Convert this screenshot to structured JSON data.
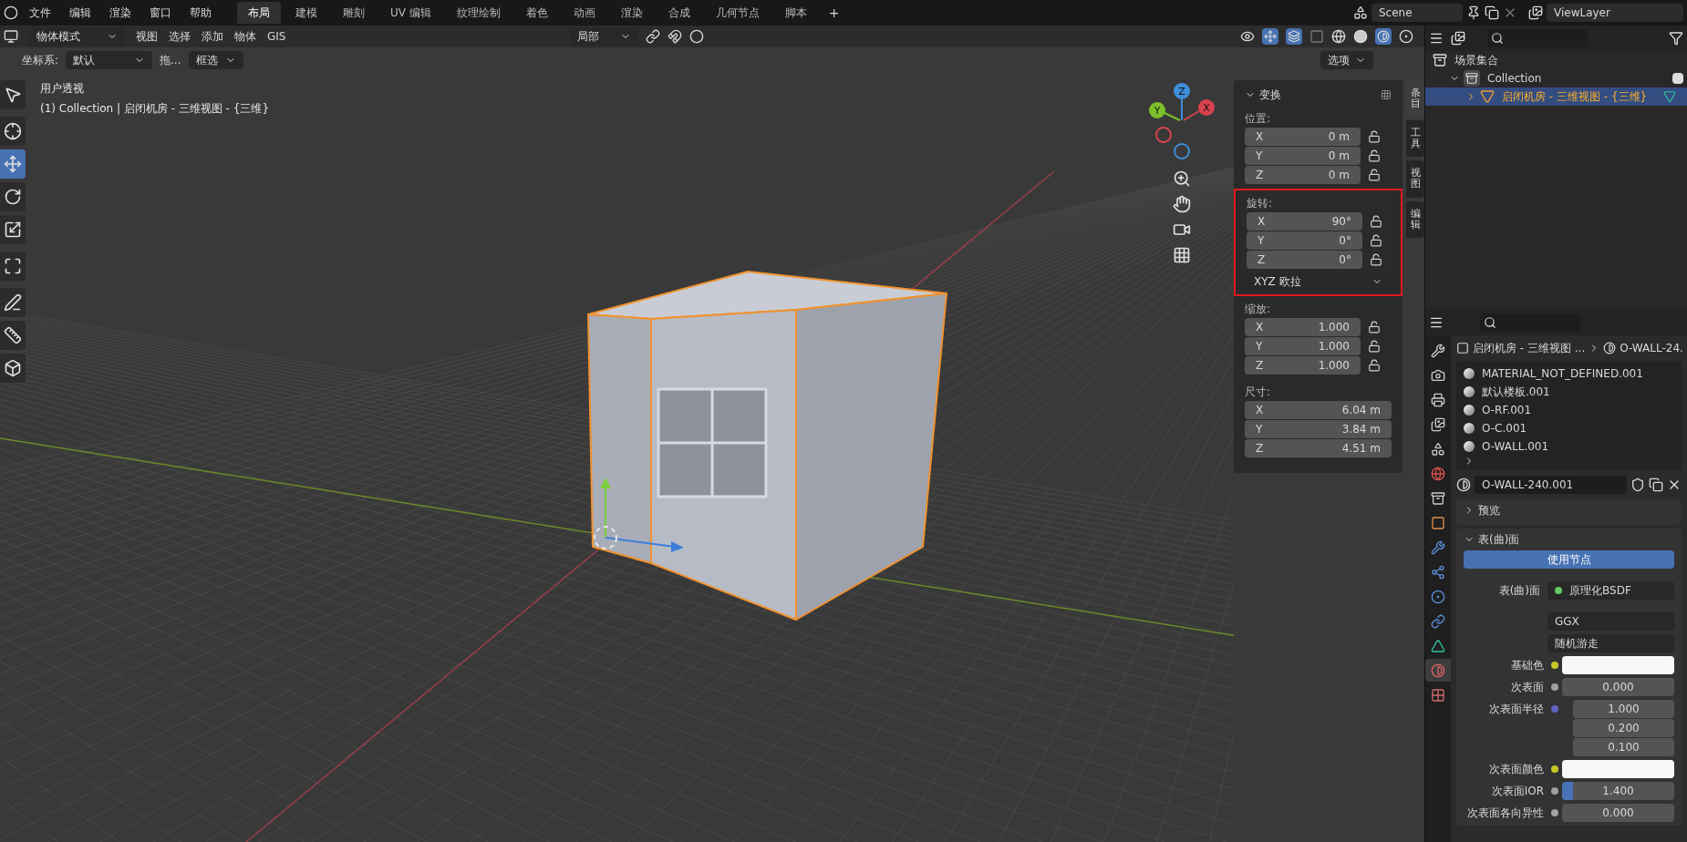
{
  "top_bar": {
    "menus": [
      "文件",
      "编辑",
      "渲染",
      "窗口",
      "帮助"
    ],
    "workspace_tabs": [
      {
        "label": "布局",
        "selected": true
      },
      {
        "label": "建模",
        "selected": false
      },
      {
        "label": "雕刻",
        "selected": false
      },
      {
        "label": "UV 编辑",
        "selected": false
      },
      {
        "label": "纹理绘制",
        "selected": false
      },
      {
        "label": "着色",
        "selected": false
      },
      {
        "label": "动画",
        "selected": false
      },
      {
        "label": "渲染",
        "selected": false
      },
      {
        "label": "合成",
        "selected": false
      },
      {
        "label": "几何节点",
        "selected": false
      },
      {
        "label": "脚本",
        "selected": false
      }
    ],
    "add_tab": "+",
    "scene": "Scene",
    "view_layer": "ViewLayer"
  },
  "viewport_header": {
    "mode": "物体模式",
    "menus": [
      "视图",
      "选择",
      "添加",
      "物体",
      "GIS"
    ],
    "pivot": "局部"
  },
  "tool_settings": {
    "orientation_label": "坐标系:",
    "orientation": "默认",
    "drag_label": "拖...",
    "drag": "框选",
    "options": "选项"
  },
  "toolbar": [
    {
      "kind": "select",
      "selected": false
    },
    {
      "kind": "cursor",
      "selected": false
    },
    {
      "kind": "move",
      "selected": true
    },
    {
      "kind": "rotate",
      "selected": false
    },
    {
      "kind": "scale",
      "selected": false
    },
    {
      "kind": "transform",
      "selected": false
    },
    {
      "kind": "annotate",
      "selected": false
    },
    {
      "kind": "measure",
      "selected": false
    },
    {
      "kind": "add_cube",
      "selected": false
    }
  ],
  "viewport": {
    "view_name": "用户透视",
    "context": "(1) Collection | 启闭机房 - 三维视图 - {三维}"
  },
  "gizmo": {
    "x": "X",
    "y": "Y",
    "z": "Z"
  },
  "n_panel": {
    "title": "变换",
    "groups": [
      {
        "label": "位置:",
        "locks": true,
        "highlighted": false,
        "rows": [
          {
            "axis": "X",
            "value": "0 m"
          },
          {
            "axis": "Y",
            "value": "0 m"
          },
          {
            "axis": "Z",
            "value": "0 m"
          }
        ]
      },
      {
        "label": "旋转:",
        "locks": true,
        "highlighted": true,
        "mode_dropdown": "XYZ 欧拉",
        "rows": [
          {
            "axis": "X",
            "value": "90°"
          },
          {
            "axis": "Y",
            "value": "0°"
          },
          {
            "axis": "Z",
            "value": "0°"
          }
        ]
      },
      {
        "label": "缩放:",
        "locks": true,
        "highlighted": false,
        "rows": [
          {
            "axis": "X",
            "value": "1.000"
          },
          {
            "axis": "Y",
            "value": "1.000"
          },
          {
            "axis": "Z",
            "value": "1.000"
          }
        ]
      },
      {
        "label": "尺寸:",
        "locks": false,
        "highlighted": false,
        "rows": [
          {
            "axis": "X",
            "value": "6.04 m"
          },
          {
            "axis": "Y",
            "value": "3.84 m"
          },
          {
            "axis": "Z",
            "value": "4.51 m"
          }
        ]
      }
    ],
    "tabs": [
      {
        "label": "条目",
        "selected": true
      },
      {
        "label": "工具",
        "selected": false
      },
      {
        "label": "视图",
        "selected": false
      },
      {
        "label": "编辑",
        "selected": false
      }
    ]
  },
  "outliner": {
    "items": [
      {
        "label": "场景集合",
        "kind": "scene",
        "children": [
          {
            "label": "Collection",
            "kind": "collection",
            "expanded": true,
            "checked": true,
            "children": [
              {
                "label": "启闭机房 - 三维视图 - {三维}",
                "kind": "object",
                "expanded": false,
                "selected": true
              }
            ]
          }
        ]
      }
    ]
  },
  "properties": {
    "tabs": [
      {
        "kind": "tool",
        "selected": false
      },
      {
        "kind": "render",
        "selected": false
      },
      {
        "kind": "output",
        "selected": false
      },
      {
        "kind": "view_layer",
        "selected": false
      },
      {
        "kind": "scene",
        "selected": false
      },
      {
        "kind": "world",
        "selected": false
      },
      {
        "kind": "collection",
        "selected": false
      },
      {
        "kind": "object",
        "selected": false
      },
      {
        "kind": "modifiers",
        "selected": false
      },
      {
        "kind": "particles",
        "selected": false
      },
      {
        "kind": "physics",
        "selected": false
      },
      {
        "kind": "constraints",
        "selected": false
      },
      {
        "kind": "data",
        "selected": false
      },
      {
        "kind": "material",
        "selected": true
      },
      {
        "kind": "texture",
        "selected": false
      }
    ],
    "breadcrumb": [
      "启闭机房 - 三维视图 ...",
      "O-WALL-24."
    ],
    "material_slots": [
      "MATERIAL_NOT_DEFINED.001",
      "默认楼板.001",
      "O-RF.001",
      "O-C.001",
      "O-WALL.001"
    ],
    "material_name": "O-WALL-240.001",
    "sections": [
      {
        "label": "预览",
        "expanded": false
      },
      {
        "label": "表(曲)面",
        "expanded": true
      }
    ],
    "use_nodes": "使用节点",
    "surface_label": "表(曲)面",
    "surface_value": "原理化BSDF",
    "distribution": "GGX",
    "subsurface_method": "随机游走",
    "inputs": [
      {
        "label": "基础色",
        "kind": "swatch",
        "color": "#c7c729"
      },
      {
        "label": "次表面",
        "kind": "number",
        "color": "#a1a1a1",
        "value": "0.000"
      },
      {
        "label": "次表面半径",
        "kind": "vector",
        "color": "#6363c7",
        "values": [
          "1.000",
          "0.200",
          "0.100"
        ]
      },
      {
        "label": "次表面颜色",
        "kind": "swatch",
        "color": "#c7c729"
      },
      {
        "label": "次表面IOR",
        "kind": "slider",
        "color": "#a1a1a1",
        "value": "1.400",
        "level": 0.1
      },
      {
        "label": "次表面各向异性",
        "kind": "number",
        "color": "#a1a1a1",
        "value": "0.000"
      }
    ]
  }
}
